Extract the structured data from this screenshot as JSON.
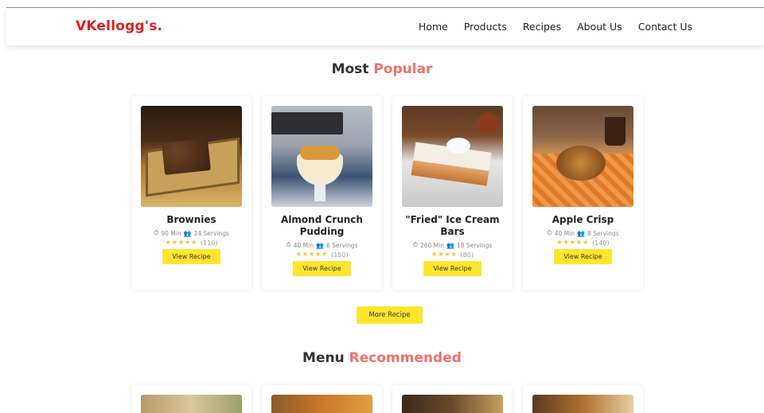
{
  "brand": "VKellogg's.",
  "nav": [
    "Home",
    "Products",
    "Recipes",
    "About Us",
    "Contact Us"
  ],
  "popular": {
    "title_main": "Most",
    "title_accent": "Popular",
    "cards": [
      {
        "title": "Brownies",
        "time": "90 Min",
        "servings": "24 Servings",
        "stars": 5,
        "rating_count": "(110)",
        "button": "View Recipe",
        "image": "brownies-photo"
      },
      {
        "title": "Almond Crunch Pudding",
        "time": "40 Min",
        "servings": "6 Servings",
        "stars": 5,
        "rating_count": "(150)",
        "button": "View Recipe",
        "image": "pudding-photo"
      },
      {
        "title": "\"Fried\" Ice Cream Bars",
        "time": "260 Min",
        "servings": "18 Servings",
        "stars": 4,
        "rating_count": "(80)",
        "button": "View Recipe",
        "image": "ice-cream-bars-photo"
      },
      {
        "title": "Apple Crisp",
        "time": "40 Min",
        "servings": "8 Servings",
        "stars": 5,
        "rating_count": "(140)",
        "button": "View Recipe",
        "image": "apple-crisp-photo"
      }
    ],
    "more_button": "More Recipe"
  },
  "recommended": {
    "title_main": "Menu",
    "title_accent": "Recommended"
  },
  "colors": {
    "brand": "#e02020",
    "accent": "#f0706a",
    "button": "#ffe52e",
    "star": "#f6c33b"
  },
  "icons": {
    "time": "stopwatch-icon",
    "servings": "people-icon",
    "star": "star-icon"
  }
}
